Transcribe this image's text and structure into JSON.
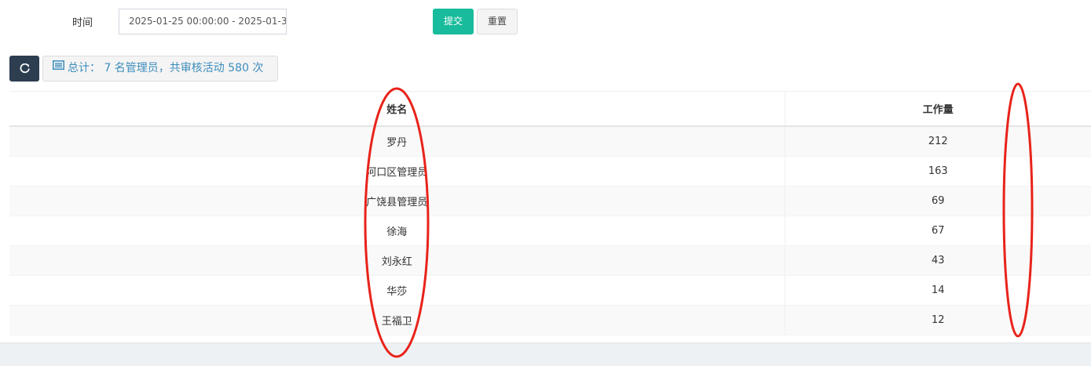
{
  "filter": {
    "time_label": "时间",
    "time_value": "2025-01-25 00:00:00 - 2025-01-3",
    "submit_label": "提交",
    "reset_label": "重置"
  },
  "toolbar": {
    "refresh_icon": "refresh-icon",
    "list_icon": "list-icon",
    "summary_text": "总计： 7 名管理员，共审核活动 580 次"
  },
  "table": {
    "headers": [
      "姓名",
      "工作量"
    ],
    "rows": [
      {
        "name": "罗丹",
        "workload": "212"
      },
      {
        "name": "河口区管理员",
        "workload": "163"
      },
      {
        "name": "广饶县管理员",
        "workload": "69"
      },
      {
        "name": "徐海",
        "workload": "67"
      },
      {
        "name": "刘永红",
        "workload": "43"
      },
      {
        "name": "华莎",
        "workload": "14"
      },
      {
        "name": "王福卫",
        "workload": "12"
      }
    ]
  },
  "colors": {
    "submit": "#18bc9c",
    "refresh": "#2c3e50",
    "summary_text": "#3c8dbc",
    "annotation": "#e8231a"
  }
}
